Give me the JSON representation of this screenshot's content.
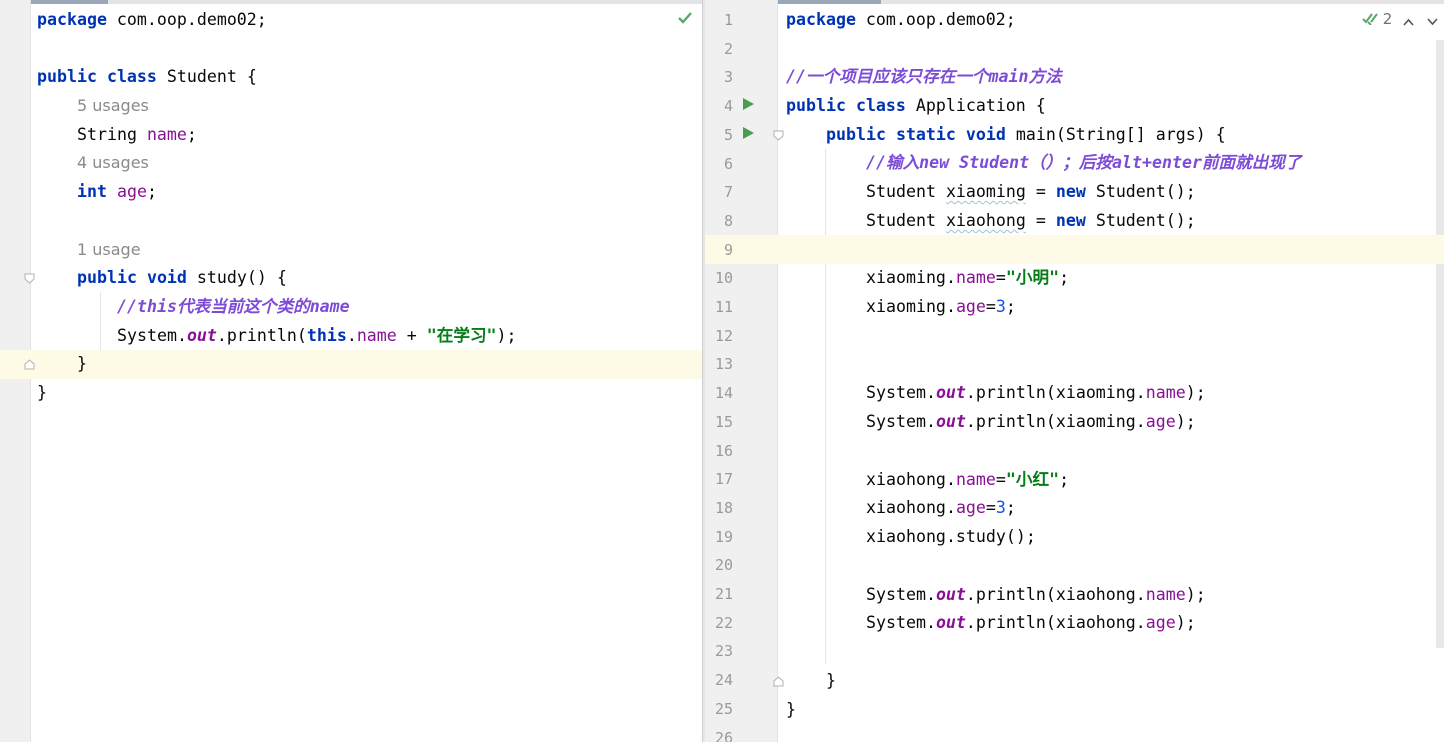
{
  "left_editor": {
    "file_status_icon": "check-icon",
    "status_color": "#59a869",
    "lines": [
      {
        "id": "l1"
      },
      {
        "id": "l2"
      },
      {
        "id": "l3"
      },
      {
        "id": "l4"
      },
      {
        "id": "l5"
      },
      {
        "id": "l6"
      },
      {
        "id": "l7"
      },
      {
        "id": "l8"
      },
      {
        "id": "l9"
      },
      {
        "id": "l10"
      },
      {
        "id": "l11"
      },
      {
        "id": "l12"
      },
      {
        "id": "l13"
      },
      {
        "id": "l14"
      }
    ],
    "text": {
      "package_kw": "package",
      "package_name": " com.oop.demo02;",
      "public_kw": "public",
      "class_kw": "class",
      "class_name": " Student {",
      "usages_5": "5 usages",
      "string_type": "String ",
      "name_field": "name",
      "semicolon": ";",
      "usages_4": "4 usages",
      "int_kw": "int",
      "age_field": "age",
      "usage_1": "1 usage",
      "void_kw": "void",
      "study_sig": " study() {",
      "comment_study": "//this代表当前这个类的name",
      "system": "System.",
      "out": "out",
      "println_open": ".println(",
      "this_kw": "this",
      "dot": ".",
      "plus": " + ",
      "study_str": "\"在学习\"",
      "close_paren": ");",
      "close_brace": "}"
    }
  },
  "right_editor": {
    "inspection_count": "2",
    "line_numbers": [
      "1",
      "2",
      "3",
      "4",
      "5",
      "6",
      "7",
      "8",
      "9",
      "10",
      "11",
      "12",
      "13",
      "14",
      "15",
      "16",
      "17",
      "18",
      "19",
      "20",
      "21",
      "22",
      "23",
      "24",
      "25",
      "26"
    ],
    "text": {
      "package_kw": "package",
      "package_name": " com.oop.demo02;",
      "comment_main": "//一个项目应该只存在一个main方法",
      "public_kw": "public",
      "class_kw": "class",
      "class_name": " Application {",
      "static_kw": "static",
      "void_kw": "void",
      "main_sig": " main(String[] args) {",
      "comment_new": "//输入new Student（）；后按alt+enter前面就出现了",
      "student_type": "Student ",
      "xiaoming": "xiaoming",
      "xiaohong": "xiaohong",
      "assign": " = ",
      "new_kw": "new",
      "student_ctor": " Student();",
      "name_field": "name",
      "age_field": "age",
      "equals": "=",
      "xiaoming_str": "\"小明\"",
      "xiaohong_str": "\"小红\"",
      "num_3": "3",
      "semicolon": ";",
      "system": "System.",
      "out": "out",
      "println_open": ".println(",
      "dot": ".",
      "close_paren": ");",
      "study_call": ".study();",
      "close_brace": "}"
    }
  }
}
